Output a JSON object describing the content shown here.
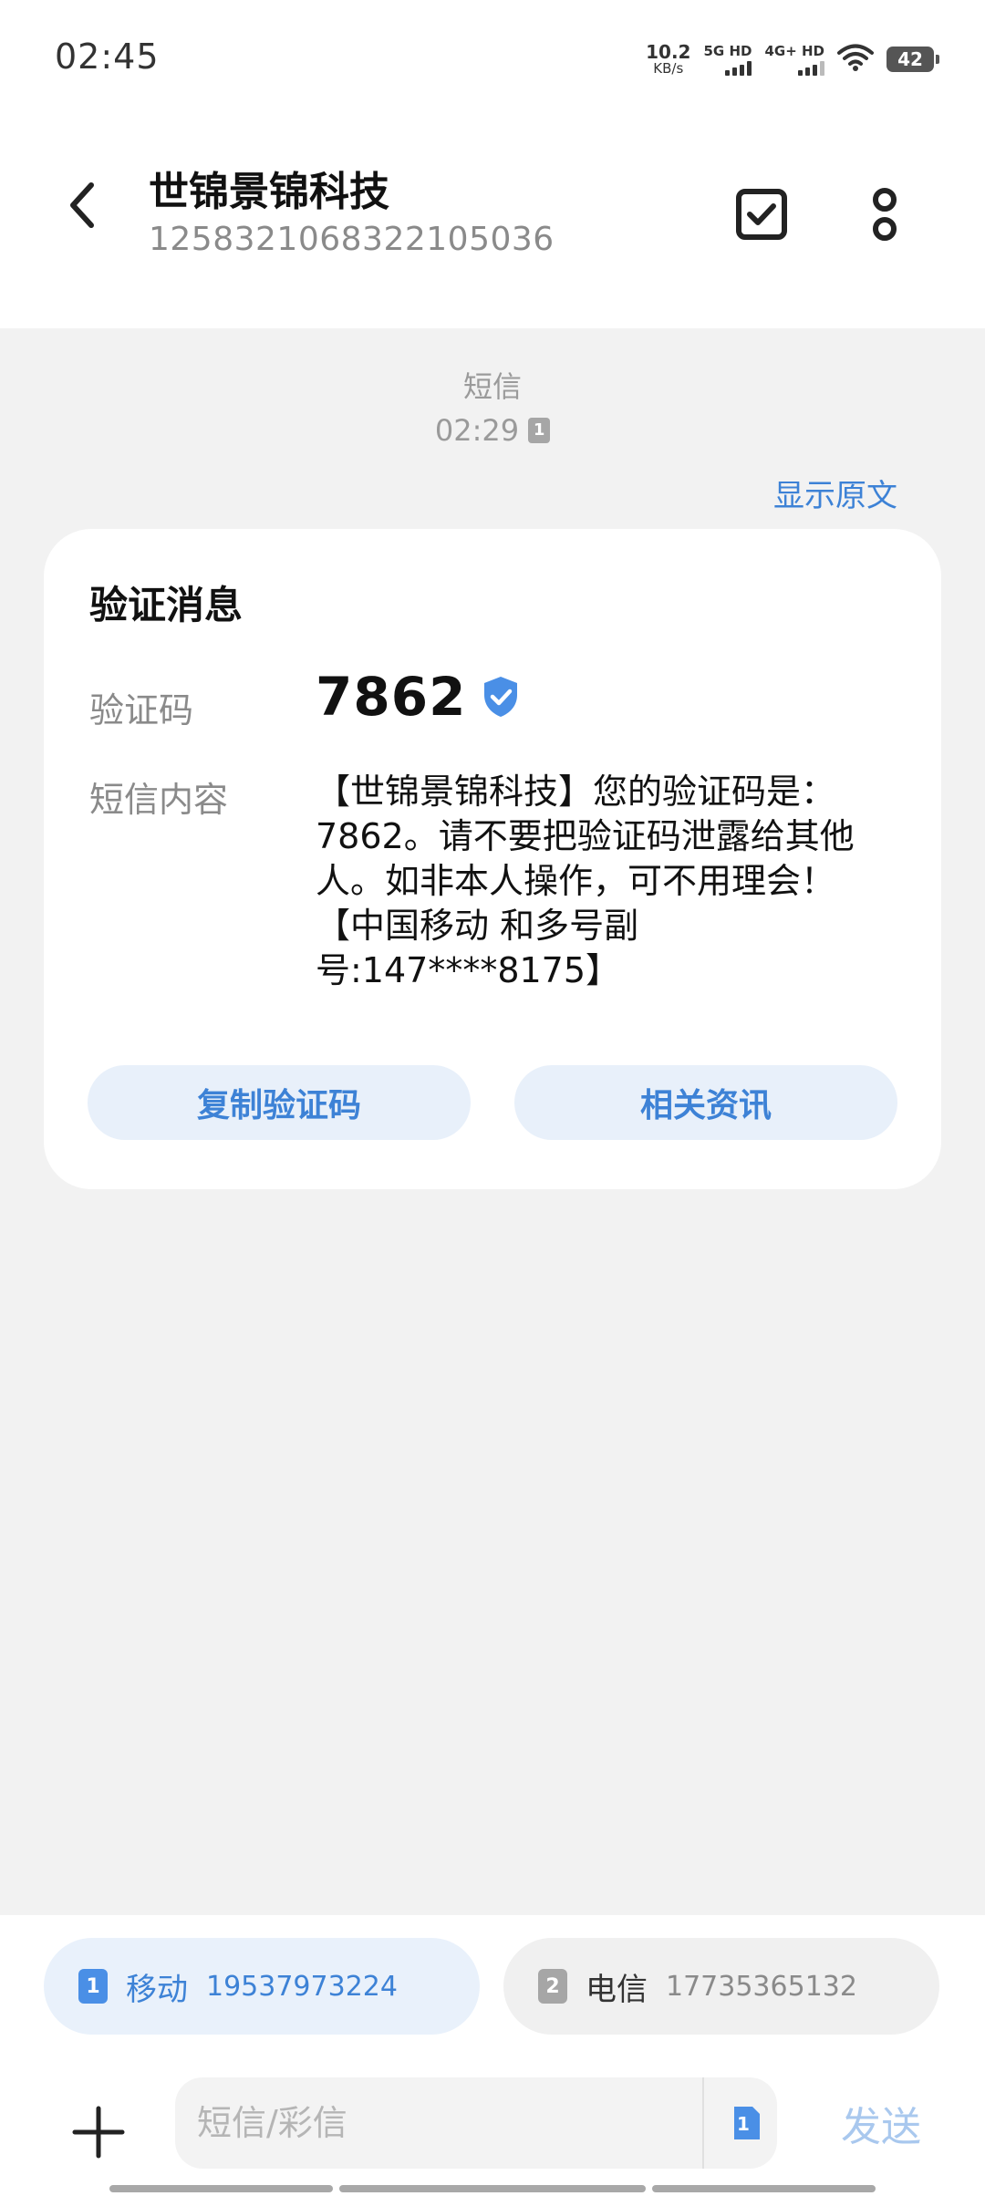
{
  "status_bar": {
    "time": "02:45",
    "net_speed_value": "10.2",
    "net_speed_unit": "KB/s",
    "sim1_signal_label": "5G HD",
    "sim2_signal_label": "4G+ HD",
    "battery": "42"
  },
  "header": {
    "title": "世锦景锦科技",
    "subtitle": "1258321068322105036"
  },
  "message_meta": {
    "type": "短信",
    "time": "02:29",
    "sim_badge": "1"
  },
  "show_original": "显示原文",
  "card": {
    "title": "验证消息",
    "code_label": "验证码",
    "code_value": "7862",
    "content_label": "短信内容",
    "body": "【世锦景锦科技】您的验证码是：7862。请不要把验证码泄露给其他人。如非本人操作，可不用理会！【中国移动 和多号副号:147****8175】",
    "copy_button": "复制验证码",
    "related_button": "相关资讯"
  },
  "sim_selector": [
    {
      "badge": "1",
      "carrier": "移动",
      "number": "19537973224"
    },
    {
      "badge": "2",
      "carrier": "电信",
      "number": "17735365132"
    }
  ],
  "compose": {
    "placeholder": "短信/彩信",
    "sim_switch_badge": "1",
    "send_label": "发送"
  },
  "colors": {
    "accent": "#3d82d6",
    "chip_active_bg": "#e9f1fb",
    "send_disabled": "#a9c8ee",
    "page_bg": "#f2f2f2"
  }
}
